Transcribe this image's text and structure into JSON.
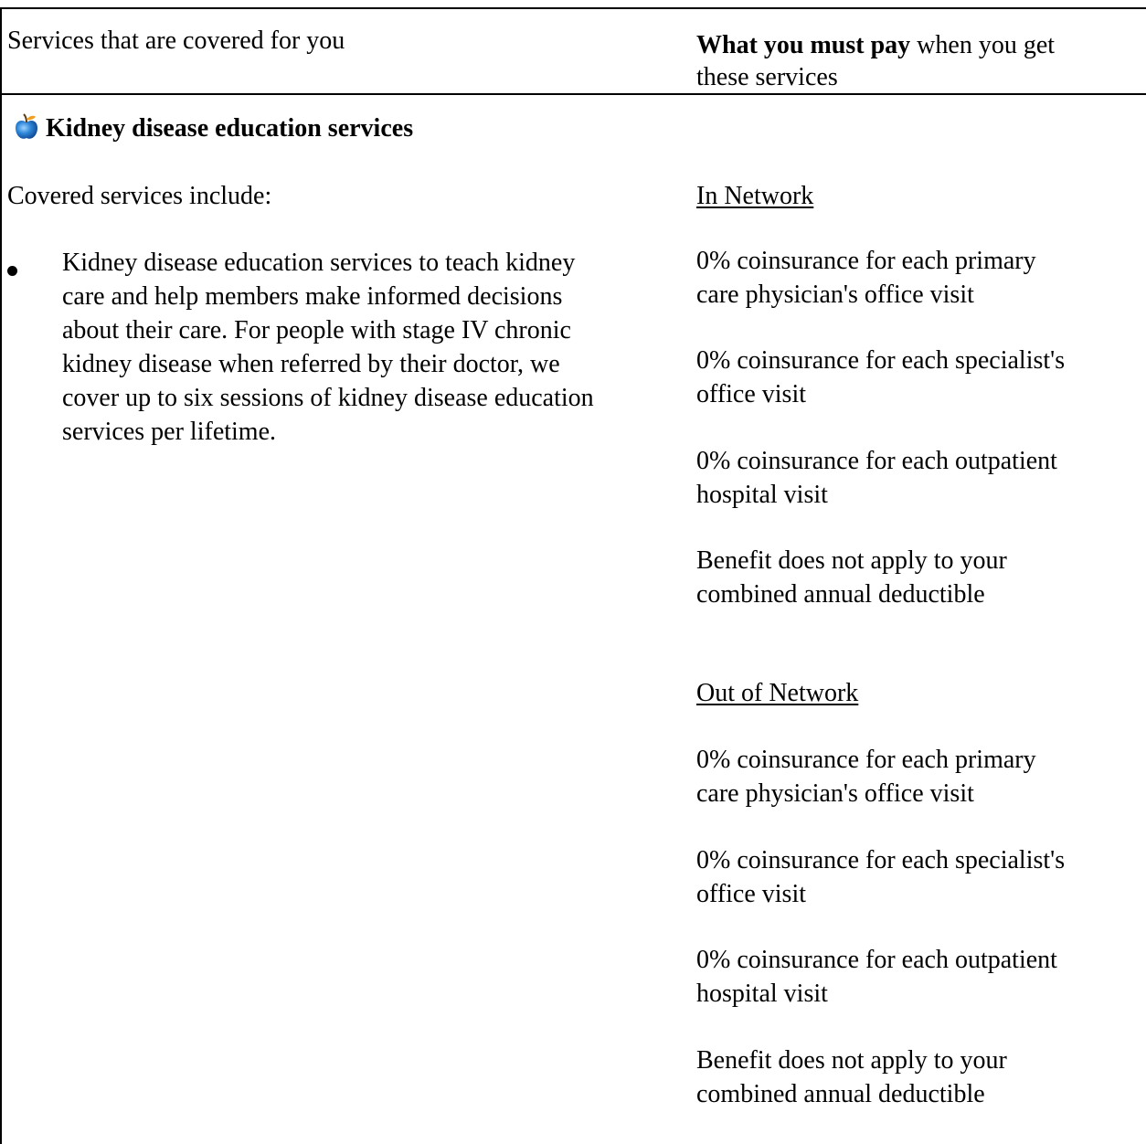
{
  "header": {
    "left": "Services that are covered for you",
    "right_bold": "What you must pay",
    "right_rest": " when you get",
    "right_line2": "these services"
  },
  "section": {
    "icon": "apple-icon",
    "title": "Kidney disease education services",
    "covered_intro": "Covered services include:",
    "bullet_lines": [
      "Kidney disease education services to teach kidney",
      "care and help members make informed decisions",
      "about their care.  For people with stage IV chronic",
      "kidney disease when referred by their doctor, we",
      "cover up to six sessions of kidney disease education",
      "services per lifetime."
    ]
  },
  "in_network": {
    "heading": "In Network",
    "items": [
      [
        "0% coinsurance for each primary",
        "care physician's office visit"
      ],
      [
        "0% coinsurance for each specialist's",
        "office visit"
      ],
      [
        "0% coinsurance for each outpatient",
        "hospital visit"
      ],
      [
        "Benefit does not apply to your",
        "combined annual deductible"
      ]
    ]
  },
  "out_of_network": {
    "heading": "Out of Network",
    "items": [
      [
        "0% coinsurance for each primary",
        "care physician's office visit"
      ],
      [
        "0% coinsurance for each specialist's",
        "office visit"
      ],
      [
        "0% coinsurance for each outpatient",
        "hospital visit"
      ],
      [
        "Benefit does not apply to your",
        "combined annual deductible"
      ]
    ]
  }
}
